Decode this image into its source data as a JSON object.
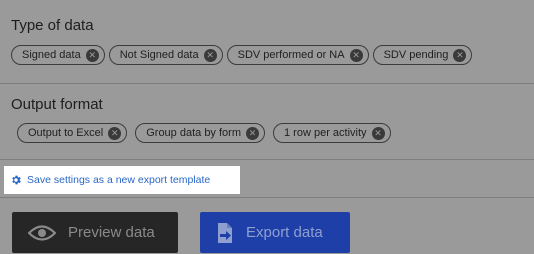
{
  "type_of_data": {
    "heading": "Type of data",
    "chips": [
      {
        "label": "Signed data"
      },
      {
        "label": "Not Signed data"
      },
      {
        "label": "SDV performed or NA"
      },
      {
        "label": "SDV pending"
      }
    ]
  },
  "output_format": {
    "heading": "Output format",
    "chips": [
      {
        "label": "Output to Excel"
      },
      {
        "label": "Group data by form"
      },
      {
        "label": "1 row per activity"
      }
    ]
  },
  "save_template": {
    "label": "Save settings as a new export template",
    "icon": "gear-icon"
  },
  "buttons": {
    "preview": {
      "label": "Preview data",
      "icon": "eye-icon"
    },
    "export": {
      "label": "Export data",
      "icon": "export-file-icon"
    }
  },
  "colors": {
    "overlay": "#9a9a9a",
    "link": "#2a67c8",
    "export_button": "#1f3fa8",
    "preview_button": "#262626"
  }
}
